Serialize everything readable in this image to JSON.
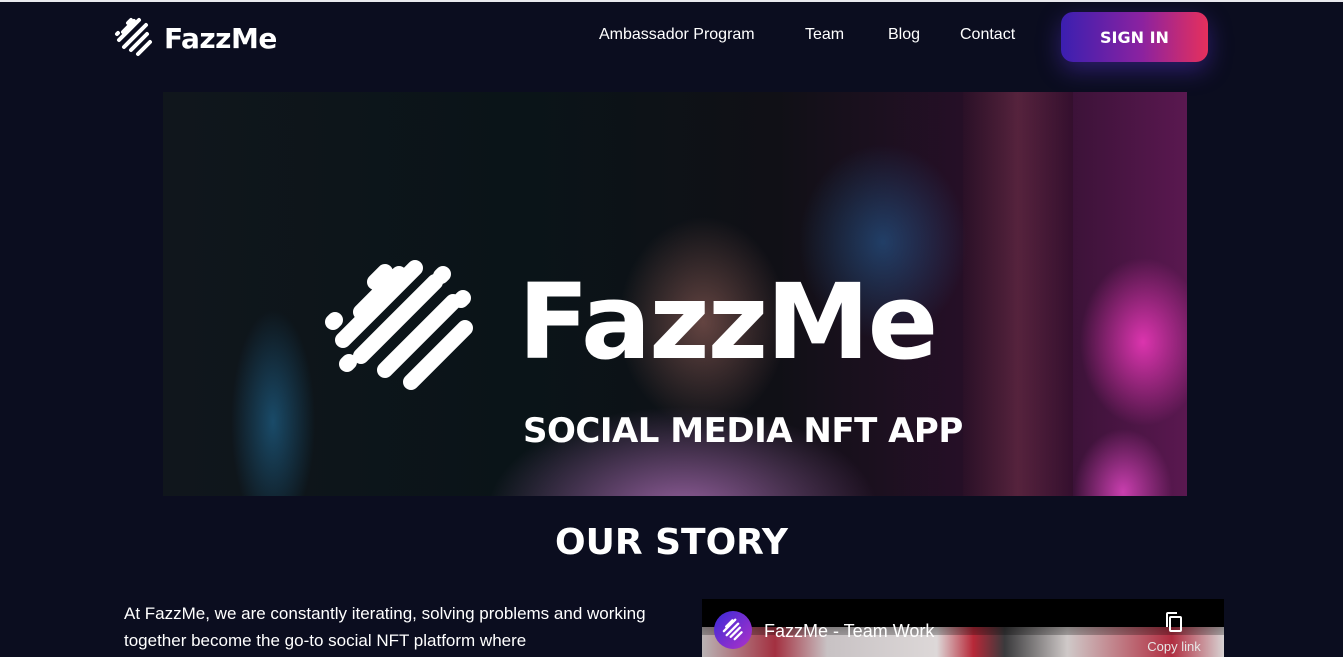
{
  "header": {
    "brand": "FazzMe",
    "nav": [
      {
        "label": "Ambassador Program"
      },
      {
        "label": "Team"
      },
      {
        "label": "Blog"
      },
      {
        "label": "Contact"
      }
    ],
    "signin_label": "SIGN IN"
  },
  "hero": {
    "brand": "FazzMe",
    "tagline": "SOCIAL MEDIA NFT APP"
  },
  "story": {
    "title": "OUR STORY",
    "text": "At FazzMe, we are constantly iterating, solving problems and working together become the go-to social NFT platform where"
  },
  "video": {
    "title": "FazzMe - Team Work",
    "copy_label": "Copy link"
  },
  "colors": {
    "background": "#0b0d1f",
    "signin_gradient_start": "#3b1fb0",
    "signin_gradient_end": "#e6305c"
  }
}
